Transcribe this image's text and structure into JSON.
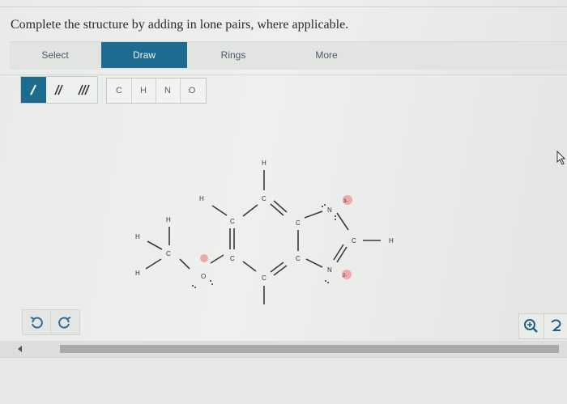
{
  "prompt": "Complete the structure by adding in lone pairs, where applicable.",
  "tabs": [
    {
      "label": "Select",
      "active": false
    },
    {
      "label": "Draw",
      "active": true
    },
    {
      "label": "Rings",
      "active": false
    },
    {
      "label": "More",
      "active": false
    }
  ],
  "bond_tools": [
    {
      "icon": "single-bond-icon",
      "active": true
    },
    {
      "icon": "double-bond-icon",
      "active": false
    },
    {
      "icon": "triple-bond-icon",
      "active": false
    }
  ],
  "atom_tools": [
    "C",
    "H",
    "N",
    "O"
  ],
  "molecule": {
    "atoms": {
      "h_top": "H",
      "c_top": "C",
      "h_left_upper": "H",
      "c_upper_left": "C",
      "c_upper_right": "C",
      "n_ring": "N",
      "n_ring_charge": "3-",
      "c_right": "C",
      "h_right": "H",
      "n_lower": "N",
      "n_lower_charge": "2-",
      "c_lower_right": "C",
      "c_bottom": "C",
      "h_bottom": "H",
      "c_lower_left": "C",
      "o_ring": "O",
      "c_methyl": "C",
      "h_methyl_top": "H",
      "h_methyl_left": "H",
      "h_methyl_bottom": "H"
    }
  },
  "colors": {
    "accent": "#1d6b8e",
    "charge_badge": "#f0a9a6"
  },
  "icons": {
    "undo": "undo-icon",
    "redo": "redo-icon",
    "zoom": "zoom-in-icon",
    "fit": "fit-icon",
    "cursor": "cursor-icon"
  }
}
